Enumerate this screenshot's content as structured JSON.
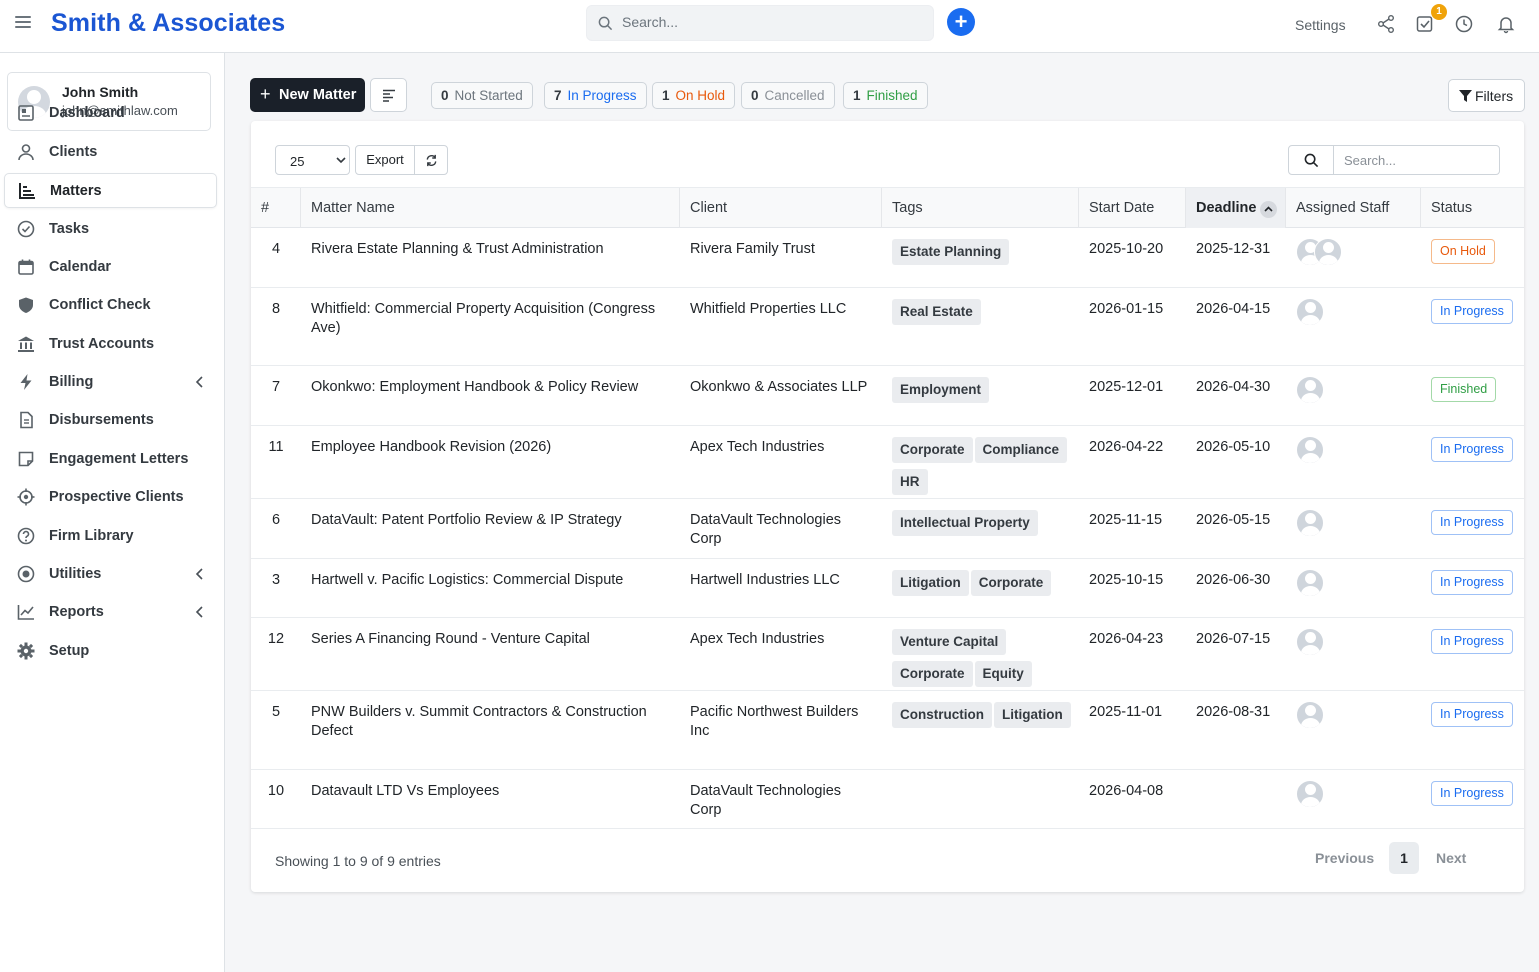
{
  "app": {
    "brand": "Smith & Associates",
    "search_placeholder": "Search...",
    "settings_label": "Settings",
    "task_badge": "1"
  },
  "user": {
    "name": "John Smith",
    "email": "john@smithlaw.com"
  },
  "nav": [
    {
      "label": "Dashboard",
      "icon": "dashboard-icon"
    },
    {
      "label": "Clients",
      "icon": "user-icon"
    },
    {
      "label": "Matters",
      "icon": "chart-icon",
      "active": true
    },
    {
      "label": "Tasks",
      "icon": "check-circle-icon"
    },
    {
      "label": "Calendar",
      "icon": "calendar-icon"
    },
    {
      "label": "Conflict Check",
      "icon": "shield-icon"
    },
    {
      "label": "Trust Accounts",
      "icon": "bank-icon"
    },
    {
      "label": "Billing",
      "icon": "bolt-icon",
      "chevron": true
    },
    {
      "label": "Disbursements",
      "icon": "file-icon"
    },
    {
      "label": "Engagement Letters",
      "icon": "note-icon"
    },
    {
      "label": "Prospective Clients",
      "icon": "crosshair-icon"
    },
    {
      "label": "Firm Library",
      "icon": "question-icon"
    },
    {
      "label": "Utilities",
      "icon": "target-icon",
      "chevron": true
    },
    {
      "label": "Reports",
      "icon": "line-chart-icon",
      "chevron": true
    },
    {
      "label": "Setup",
      "icon": "gear-icon"
    }
  ],
  "toolbar": {
    "new_matter": "New Matter",
    "filters": "Filters"
  },
  "statuses": [
    {
      "count": "0",
      "label": "Not Started",
      "color": "#6c757d"
    },
    {
      "count": "7",
      "label": "In Progress",
      "color": "#1a6cf0"
    },
    {
      "count": "1",
      "label": "On Hold",
      "color": "#e8590c"
    },
    {
      "count": "0",
      "label": "Cancelled",
      "color": "#8a9097"
    },
    {
      "count": "1",
      "label": "Finished",
      "color": "#2f9e44"
    }
  ],
  "table": {
    "page_size": "25",
    "export_label": "Export",
    "search_placeholder": "Search...",
    "columns": [
      "#",
      "Matter Name",
      "Client",
      "Tags",
      "Start Date",
      "Deadline",
      "Assigned Staff",
      "Status"
    ],
    "rows": [
      {
        "num": "4",
        "name": "Rivera Estate Planning & Trust Administration",
        "client": "Rivera Family Trust",
        "tags": [
          "Estate Planning"
        ],
        "start": "2025-10-20",
        "deadline": "2025-12-31",
        "staff": 2,
        "status": "On Hold",
        "kind": "hold"
      },
      {
        "num": "8",
        "name": "Whitfield: Commercial Property Acquisition (Congress Ave)",
        "client": "Whitfield Properties LLC",
        "tags": [
          "Real Estate"
        ],
        "start": "2026-01-15",
        "deadline": "2026-04-15",
        "staff": 1,
        "status": "In Progress",
        "kind": "prog"
      },
      {
        "num": "7",
        "name": "Okonkwo: Employment Handbook & Policy Review",
        "client": "Okonkwo & Associates LLP",
        "tags": [
          "Employment"
        ],
        "start": "2025-12-01",
        "deadline": "2026-04-30",
        "staff": 1,
        "status": "Finished",
        "kind": "fin"
      },
      {
        "num": "11",
        "name": "Employee Handbook Revision (2026)",
        "client": "Apex Tech Industries",
        "tags": [
          "Corporate",
          "Compliance",
          "HR"
        ],
        "start": "2026-04-22",
        "deadline": "2026-05-10",
        "staff": 1,
        "status": "In Progress",
        "kind": "prog"
      },
      {
        "num": "6",
        "name": "DataVault: Patent Portfolio Review & IP Strategy",
        "client": "DataVault Technologies Corp",
        "tags": [
          "Intellectual Property"
        ],
        "start": "2025-11-15",
        "deadline": "2026-05-15",
        "staff": 1,
        "status": "In Progress",
        "kind": "prog"
      },
      {
        "num": "3",
        "name": "Hartwell v. Pacific Logistics: Commercial Dispute",
        "client": "Hartwell Industries LLC",
        "tags": [
          "Litigation",
          "Corporate"
        ],
        "start": "2025-10-15",
        "deadline": "2026-06-30",
        "staff": 1,
        "status": "In Progress",
        "kind": "prog"
      },
      {
        "num": "12",
        "name": "Series A Financing Round - Venture Capital",
        "client": "Apex Tech Industries",
        "tags": [
          "Venture Capital",
          "Corporate",
          "Equity"
        ],
        "start": "2026-04-23",
        "deadline": "2026-07-15",
        "staff": 1,
        "status": "In Progress",
        "kind": "prog"
      },
      {
        "num": "5",
        "name": "PNW Builders v. Summit Contractors & Construction Defect",
        "client": "Pacific Northwest Builders Inc",
        "tags": [
          "Construction",
          "Litigation"
        ],
        "start": "2025-11-01",
        "deadline": "2026-08-31",
        "staff": 1,
        "status": "In Progress",
        "kind": "prog"
      },
      {
        "num": "10",
        "name": "Datavault LTD Vs Employees",
        "client": "DataVault Technologies Corp",
        "tags": [],
        "start": "2026-04-08",
        "deadline": "",
        "staff": 1,
        "status": "In Progress",
        "kind": "prog"
      }
    ]
  },
  "footer": {
    "info": "Showing 1 to 9 of 9 entries",
    "prev": "Previous",
    "page": "1",
    "next": "Next"
  }
}
